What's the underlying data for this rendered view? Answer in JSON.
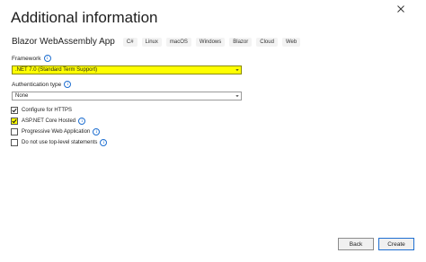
{
  "header": {
    "title": "Additional information"
  },
  "project": {
    "name": "Blazor WebAssembly App",
    "tags": [
      "C#",
      "Linux",
      "macOS",
      "Windows",
      "Blazor",
      "Cloud",
      "Web"
    ]
  },
  "framework": {
    "label": "Framework",
    "value": ".NET 7.0 (Standard Term Support)"
  },
  "auth": {
    "label": "Authentication type",
    "value": "None"
  },
  "options": [
    {
      "label": "Configure for HTTPS",
      "checked": true,
      "info": false
    },
    {
      "label": "ASP.NET Core Hosted",
      "checked": true,
      "info": true
    },
    {
      "label": "Progressive Web Application",
      "checked": false,
      "info": true
    },
    {
      "label": "Do not use top-level statements",
      "checked": false,
      "info": true
    }
  ],
  "footer": {
    "back_label": "Back",
    "create_label": "Create"
  },
  "colors": {
    "highlight": "#ffff00",
    "accent": "#1f6fd1"
  }
}
